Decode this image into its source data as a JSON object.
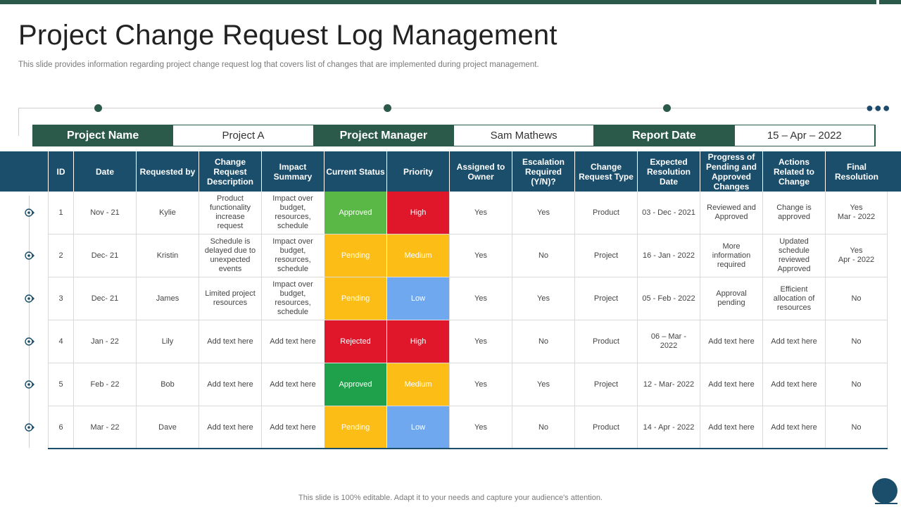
{
  "title": "Project Change Request Log Management",
  "subtitle": "This slide provides information regarding project change request log that covers list of changes that are implemented during project management.",
  "info": {
    "project_name_label": "Project Name",
    "project_name_value": "Project A",
    "project_manager_label": "Project Manager",
    "project_manager_value": "Sam Mathews",
    "report_date_label": "Report Date",
    "report_date_value": "15 – Apr – 2022"
  },
  "table": {
    "headers": [
      "ID",
      "Date",
      "Requested by",
      "Change Request Description",
      "Impact Summary",
      "Current Status",
      "Priority",
      "Assigned to Owner",
      "Escalation Required (Y/N)?",
      "Change Request Type",
      "Expected Resolution Date",
      "Progress of Pending and Approved Changes",
      "Actions Related to Change",
      "Final Resolution"
    ],
    "rows": [
      [
        "1",
        "Nov - 21",
        "Kylie",
        "Product functionality increase request",
        "Impact over budget, resources, schedule",
        "Approved",
        "High",
        "Yes",
        "Yes",
        "Product",
        "03 - Dec - 2021",
        "Reviewed and Approved",
        "Change is approved",
        "Yes\nMar - 2022"
      ],
      [
        "2",
        "Dec- 21",
        "Kristin",
        "Schedule is delayed due to unexpected events",
        "Impact over budget, resources, schedule",
        "Pending",
        "Medium",
        "Yes",
        "No",
        "Project",
        "16 - Jan - 2022",
        "More information required",
        "Updated schedule reviewed Approved",
        "Yes\nApr - 2022"
      ],
      [
        "3",
        "Dec- 21",
        "James",
        "Limited project resources",
        "Impact over budget, resources, schedule",
        "Pending",
        "Low",
        "Yes",
        "Yes",
        "Project",
        "05 - Feb - 2022",
        "Approval pending",
        "Efficient allocation of resources",
        "No"
      ],
      [
        "4",
        "Jan - 22",
        "Lily",
        "Add text here",
        "Add text here",
        "Rejected",
        "High",
        "Yes",
        "No",
        "Product",
        "06 – Mar - 2022",
        "Add text here",
        "Add text here",
        "No"
      ],
      [
        "5",
        "Feb - 22",
        "Bob",
        "Add text here",
        "Add text here",
        "Approved",
        "Medium",
        "Yes",
        "Yes",
        "Project",
        "12 - Mar- 2022",
        "Add text here",
        "Add text here",
        "No"
      ],
      [
        "6",
        "Mar - 22",
        "Dave",
        "Add text here",
        "Add text here",
        "Pending",
        "Low",
        "Yes",
        "No",
        "Product",
        "14 - Apr - 2022",
        "Add text here",
        "Add text here",
        "No"
      ]
    ]
  },
  "colors": {
    "header_bg": "#1b4e6b",
    "accent_green": "#2b5a4a",
    "status_approved_row1": "#5ab946",
    "status_approved_row5": "#1fa04a",
    "status_pending": "#fbbd16",
    "status_rejected": "#e0162b",
    "priority_high": "#e0162b",
    "priority_medium": "#fbbd16",
    "priority_low": "#6fa8ef"
  },
  "footer": "This slide is 100% editable. Adapt it to your needs and capture your audience's attention."
}
